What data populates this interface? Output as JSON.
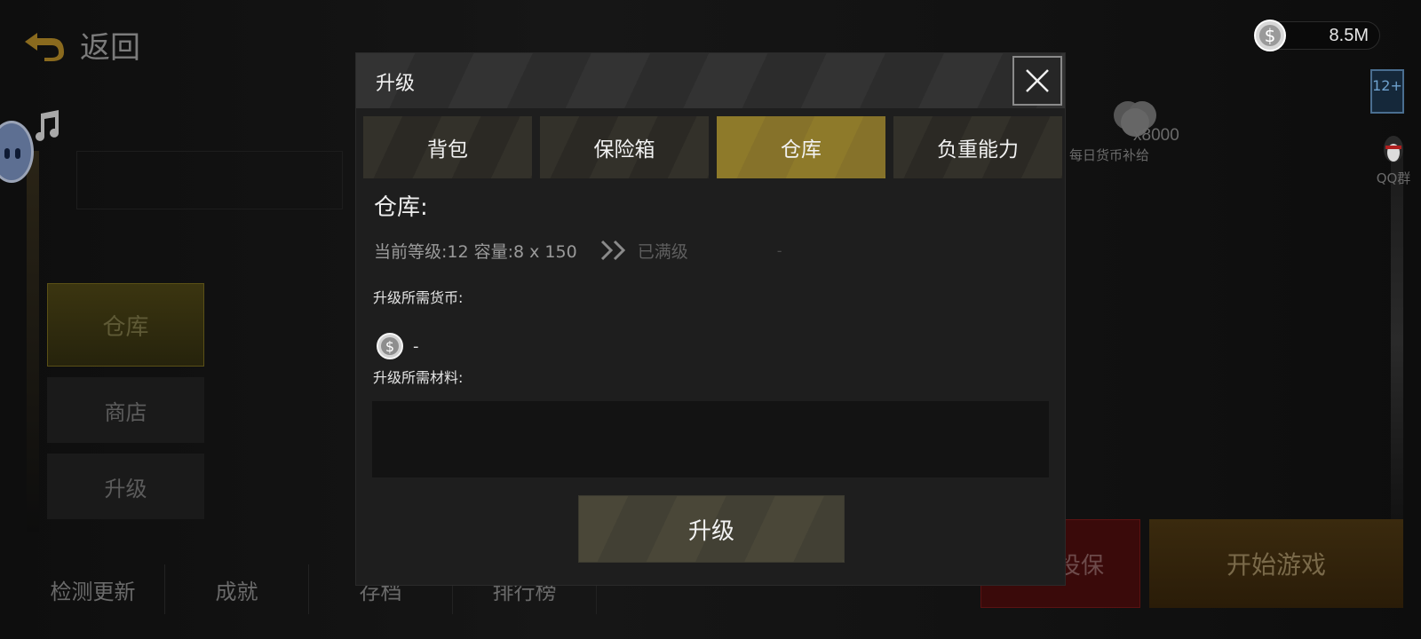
{
  "background": {
    "back_label": "返回",
    "side_menu": [
      "仓库",
      "商店",
      "升级"
    ],
    "bottom_nav": [
      "检测更新",
      "成就",
      "存档",
      "排行榜"
    ],
    "currency_amount": "8.5M",
    "age_rating": "12+",
    "qq_label": "QQ群",
    "daily_reward": {
      "count": "x8000",
      "label": "每日货币补给"
    },
    "red_button": "投保",
    "start_button": "开始游戏"
  },
  "dialog": {
    "title": "升级",
    "tabs": [
      {
        "label": "背包",
        "active": false
      },
      {
        "label": "保险箱",
        "active": false
      },
      {
        "label": "仓库",
        "active": true
      },
      {
        "label": "负重能力",
        "active": false
      }
    ],
    "section_title": "仓库:",
    "current_level_text": "当前等级:12 容量:8 x 150",
    "next_level_text": "已满级",
    "next_level_value": "-",
    "currency_label": "升级所需货币:",
    "currency_value": "-",
    "materials_label": "升级所需材料:",
    "upgrade_button": "升级"
  },
  "colors": {
    "active_tab": "#8e7a2a",
    "dialog_bg": "#1e1e1e",
    "header_bg": "#333333"
  },
  "icons": [
    "back-arrow-icon",
    "music-note-icon",
    "coin-icon",
    "close-icon",
    "double-chevron-icon",
    "qq-penguin-icon"
  ]
}
